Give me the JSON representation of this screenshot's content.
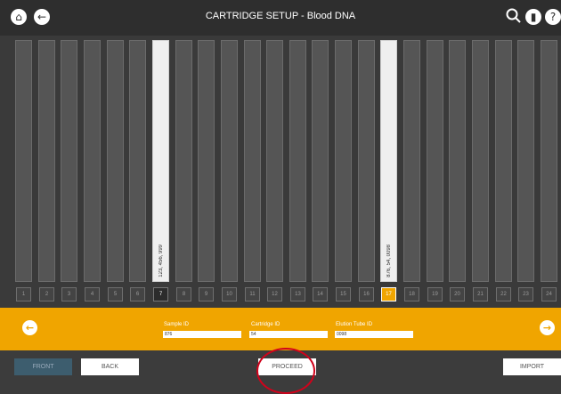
{
  "header": {
    "title": "CARTRIDGE SETUP - Blood DNA",
    "left_icons": [
      "home-icon",
      "back-icon"
    ],
    "right_icons": [
      "search-icon",
      "battery-icon",
      "help-icon"
    ]
  },
  "positions": [
    {
      "number": "1",
      "state": "empty",
      "label": ""
    },
    {
      "number": "2",
      "state": "empty",
      "label": ""
    },
    {
      "number": "3",
      "state": "empty",
      "label": ""
    },
    {
      "number": "4",
      "state": "empty",
      "label": ""
    },
    {
      "number": "5",
      "state": "empty",
      "label": ""
    },
    {
      "number": "6",
      "state": "empty",
      "label": ""
    },
    {
      "number": "7",
      "state": "selected",
      "label": "123, 456, 999"
    },
    {
      "number": "8",
      "state": "empty",
      "label": ""
    },
    {
      "number": "9",
      "state": "empty",
      "label": ""
    },
    {
      "number": "10",
      "state": "empty",
      "label": ""
    },
    {
      "number": "11",
      "state": "empty",
      "label": ""
    },
    {
      "number": "12",
      "state": "empty",
      "label": ""
    },
    {
      "number": "13",
      "state": "empty",
      "label": ""
    },
    {
      "number": "14",
      "state": "empty",
      "label": ""
    },
    {
      "number": "15",
      "state": "empty",
      "label": ""
    },
    {
      "number": "16",
      "state": "empty",
      "label": ""
    },
    {
      "number": "17",
      "state": "active",
      "label": "876, 54, 0098"
    },
    {
      "number": "18",
      "state": "empty",
      "label": ""
    },
    {
      "number": "19",
      "state": "empty",
      "label": ""
    },
    {
      "number": "20",
      "state": "empty",
      "label": ""
    },
    {
      "number": "21",
      "state": "empty",
      "label": ""
    },
    {
      "number": "22",
      "state": "empty",
      "label": ""
    },
    {
      "number": "23",
      "state": "empty",
      "label": ""
    },
    {
      "number": "24",
      "state": "empty",
      "label": ""
    }
  ],
  "form": {
    "sample_id_label": "Sample ID",
    "sample_id_value": "876",
    "cartridge_id_label": "Cartridge ID",
    "cartridge_id_value": "54",
    "elution_tube_id_label": "Elution Tube ID",
    "elution_tube_id_value": "0098"
  },
  "buttons": {
    "front": "FRONT",
    "back": "BACK",
    "proceed": "PROCEED",
    "import": "IMPORT"
  },
  "colors": {
    "accent": "#f0a500",
    "highlight_circle": "#d0021b"
  }
}
